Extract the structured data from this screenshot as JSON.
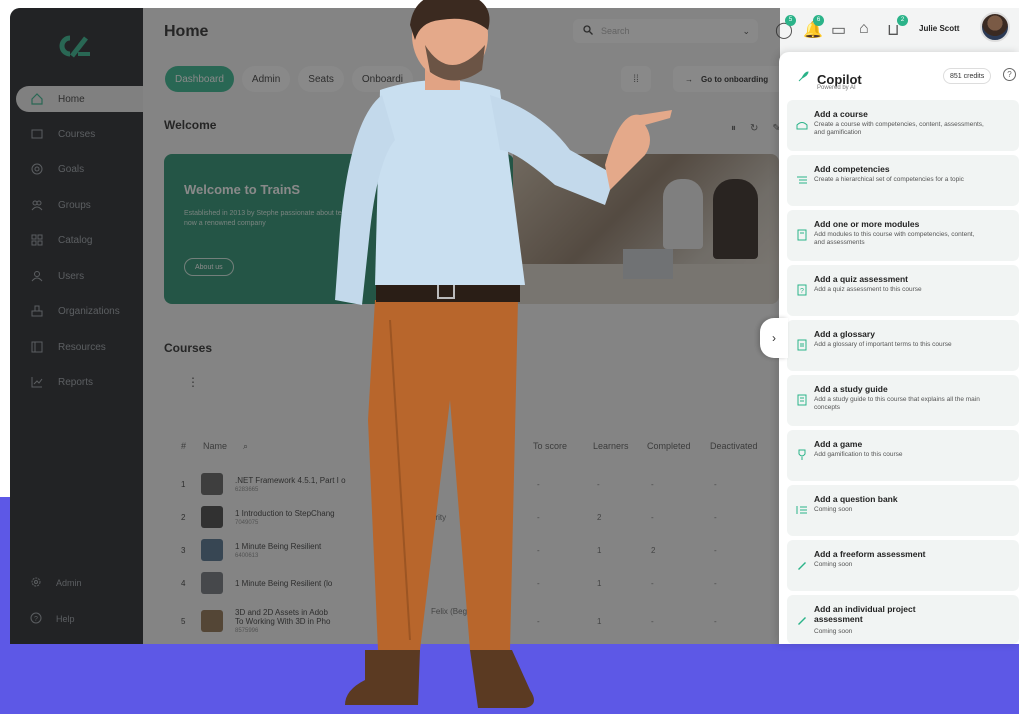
{
  "sidebar": {
    "items": [
      {
        "label": "Home"
      },
      {
        "label": "Courses"
      },
      {
        "label": "Goals"
      },
      {
        "label": "Groups"
      },
      {
        "label": "Catalog"
      },
      {
        "label": "Users"
      },
      {
        "label": "Organizations"
      },
      {
        "label": "Resources"
      },
      {
        "label": "Reports"
      }
    ],
    "bottom": [
      {
        "label": "Admin"
      },
      {
        "label": "Help"
      }
    ]
  },
  "header": {
    "title": "Home",
    "search_placeholder": "Search",
    "user_name": "Julie Scott",
    "badges": [
      "5",
      "6",
      "2"
    ]
  },
  "tabs": [
    {
      "label": "Dashboard"
    },
    {
      "label": "Admin"
    },
    {
      "label": "Seats"
    },
    {
      "label": "Onboardi"
    }
  ],
  "onboarding_button": "Go to onboarding",
  "welcome": {
    "section_title": "Welcome",
    "card_title": "Welcome to TrainS",
    "card_text": "Established in 2013 by Stephe passionate about teaching s now a renowned company",
    "about_button": "About us"
  },
  "courses": {
    "section_title": "Courses",
    "headers": [
      "#",
      "Name",
      "To score",
      "Learners",
      "Completed",
      "Deactivated"
    ],
    "rows": [
      {
        "num": "1",
        "title": ".NET Framework 4.5.1, Part I o",
        "code": "6283665",
        "to_score": "-",
        "learners": "-",
        "completed": "-",
        "deactivated": "-"
      },
      {
        "num": "2",
        "title": "1 Introduction to StepChang",
        "title_tail": "arity",
        "code": "7049075",
        "to_score": "-",
        "learners": "2",
        "completed": "-",
        "deactivated": "-"
      },
      {
        "num": "3",
        "title": "1 Minute Being Resilient",
        "code": "6400613",
        "to_score": "-",
        "learners": "1",
        "completed": "2",
        "deactivated": "-"
      },
      {
        "num": "4",
        "title": "1 Minute Being Resilient (lo",
        "code": "",
        "to_score": "-",
        "learners": "1",
        "completed": "-",
        "deactivated": "-"
      },
      {
        "num": "5",
        "title": "3D and 2D Assets in Adob",
        "title_tail": "Felix (Beginn",
        "subtitle": "To Working With 3D in Pho",
        "code": "8575996",
        "to_score": "-",
        "learners": "1",
        "completed": "-",
        "deactivated": "-"
      }
    ]
  },
  "copilot": {
    "title": "Copilot",
    "subtitle": "Powered by AI",
    "credits": "851 credits",
    "help": "?",
    "cards": [
      {
        "title": "Add a course",
        "desc": "Create a course with competencies, content, assessments, and gamification",
        "icon": "course-icon"
      },
      {
        "title": "Add competencies",
        "desc": "Create a hierarchical set of competencies for a topic",
        "icon": "list-icon"
      },
      {
        "title": "Add one or more modules",
        "desc": "Add modules to this course with competencies, content, and assessments",
        "icon": "module-icon"
      },
      {
        "title": "Add a quiz assessment",
        "desc": "Add a quiz assessment to this course",
        "icon": "quiz-icon"
      },
      {
        "title": "Add a glossary",
        "desc": "Add a glossary of important terms to this course",
        "icon": "glossary-icon"
      },
      {
        "title": "Add a study guide",
        "desc": "Add a study guide to this course that explains all the main concepts",
        "icon": "guide-icon"
      },
      {
        "title": "Add a game",
        "desc": "Add gamification to this course",
        "icon": "trophy-icon"
      },
      {
        "title": "Add a question bank",
        "desc": "Coming soon",
        "icon": "question-bank-icon"
      },
      {
        "title": "Add a freeform assessment",
        "desc": "Coming soon",
        "icon": "pencil-icon"
      },
      {
        "title": "Add an individual project assessment",
        "desc": "Coming soon",
        "icon": "pencil-icon"
      }
    ]
  },
  "colors": {
    "accent": "#2bb389",
    "band": "#5d58e6",
    "sidebar": "#1c1e22"
  }
}
